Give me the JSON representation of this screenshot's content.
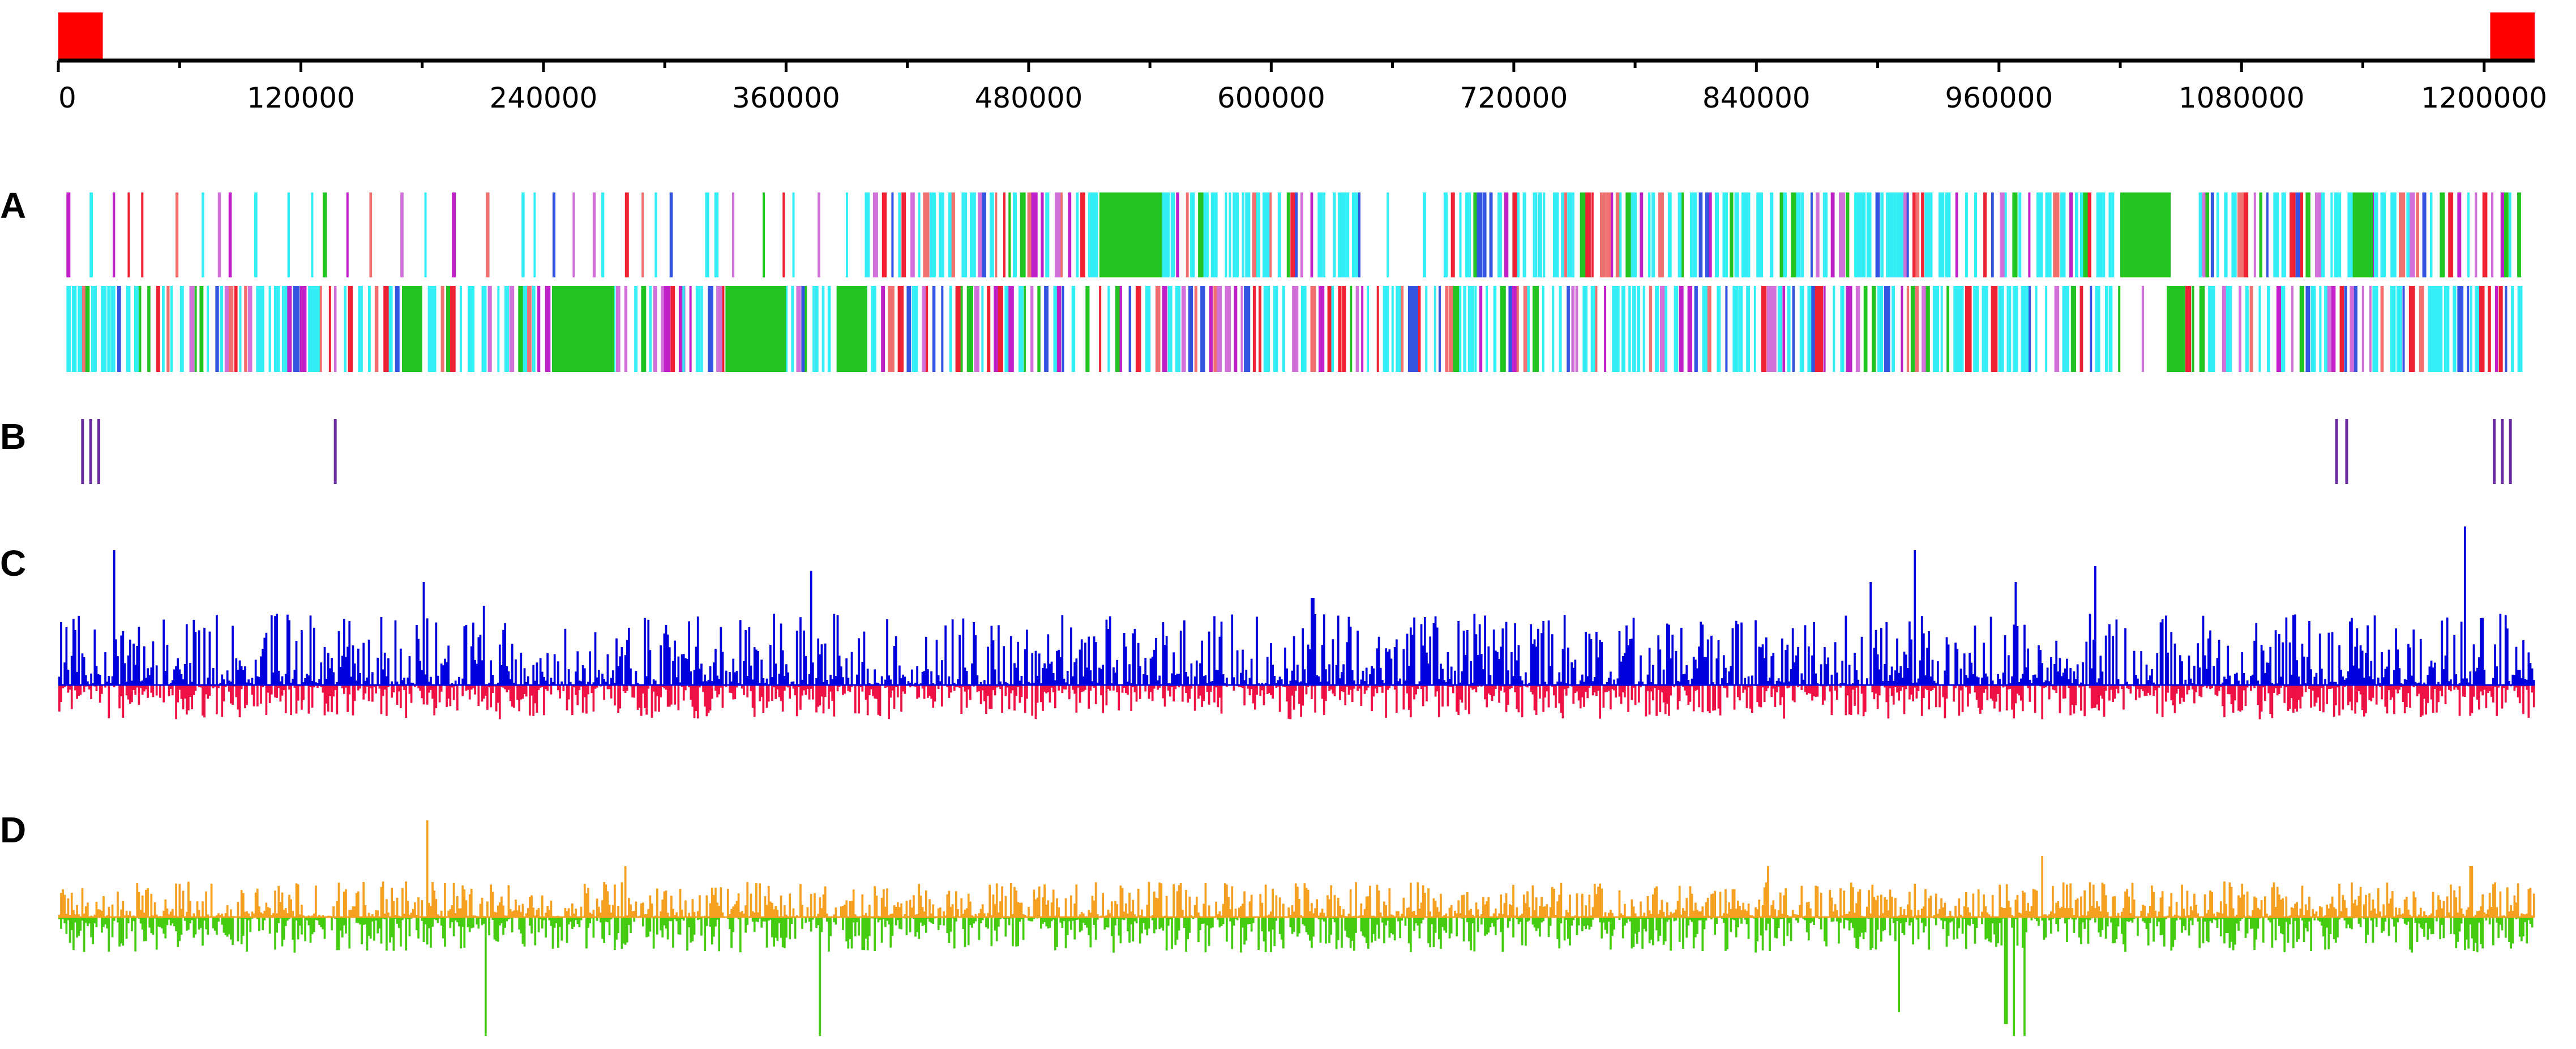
{
  "panels": {
    "A": {
      "label": "A"
    },
    "B": {
      "label": "B"
    },
    "C": {
      "label": "C"
    },
    "D": {
      "label": "D"
    }
  },
  "chart_data": {
    "type": "genome_map",
    "title": "",
    "xlabel": "",
    "ylabel": "",
    "xlim": [
      0,
      1225000
    ],
    "ticks": {
      "major": [
        0,
        120000,
        240000,
        360000,
        480000,
        600000,
        720000,
        840000,
        960000,
        1080000,
        1200000
      ],
      "labels": [
        "0",
        "120000",
        "240000",
        "360000",
        "480000",
        "600000",
        "720000",
        "840000",
        "960000",
        "1080000",
        "1200000"
      ],
      "minor_step": 60000
    },
    "colors": {
      "ruler": "#000000",
      "origin_marker": "#ff0000",
      "feature_cyan": "#33eef5",
      "feature_green": "#22c422",
      "feature_red": "#ee2233",
      "feature_magenta": "#c020c8",
      "feature_orchid": "#d070d8",
      "feature_blue": "#3355e0",
      "feature_salmon": "#f07070",
      "rna_marker": "#6a2aa0",
      "c_positive": "#0000dd",
      "c_negative": "#ee1144",
      "d_positive": "#f5a020",
      "d_negative": "#44cc11"
    },
    "ruler_markers": [
      {
        "start": 0,
        "end": 22000
      },
      {
        "start": 1203000,
        "end": 1225000
      }
    ],
    "panel_B_markers": [
      12000,
      16000,
      20000,
      137000,
      1127000,
      1132000,
      1205000,
      1209000,
      1213000
    ],
    "panel_A_dense_regions": [
      {
        "strand": "forward",
        "start": 390000,
        "end": 640000
      },
      {
        "strand": "forward",
        "start": 680000,
        "end": 1015000
      },
      {
        "strand": "forward",
        "start": 1045000,
        "end": 1225000
      },
      {
        "strand": "reverse",
        "start": 0,
        "end": 500000
      },
      {
        "strand": "reverse",
        "start": 510000,
        "end": 1015000
      },
      {
        "strand": "reverse",
        "start": 1045000,
        "end": 1225000
      }
    ],
    "panel_A_green_blocks": [
      {
        "strand": "forward",
        "start": 515000,
        "end": 545000
      },
      {
        "strand": "forward",
        "start": 1020000,
        "end": 1045000
      },
      {
        "strand": "forward",
        "start": 1135000,
        "end": 1145000
      },
      {
        "strand": "reverse",
        "start": 170000,
        "end": 180000
      },
      {
        "strand": "reverse",
        "start": 245000,
        "end": 275000
      },
      {
        "strand": "reverse",
        "start": 330000,
        "end": 360000
      },
      {
        "strand": "reverse",
        "start": 385000,
        "end": 400000
      },
      {
        "strand": "reverse",
        "start": 1043000,
        "end": 1052000
      }
    ],
    "panel_C_peaks": [
      {
        "x": 27000,
        "y": 0.85
      },
      {
        "x": 180000,
        "y": 0.65
      },
      {
        "x": 210000,
        "y": 0.5
      },
      {
        "x": 372000,
        "y": 0.72
      },
      {
        "x": 620000,
        "y": 0.55
      },
      {
        "x": 896000,
        "y": 0.65
      },
      {
        "x": 918000,
        "y": 0.85
      },
      {
        "x": 968000,
        "y": 0.65
      },
      {
        "x": 1007000,
        "y": 0.75
      },
      {
        "x": 1190000,
        "y": 1.0
      }
    ],
    "panel_D_peaks": [
      {
        "x": 182000,
        "y": 0.95
      },
      {
        "x": 280000,
        "y": 0.5
      },
      {
        "x": 845000,
        "y": 0.5
      },
      {
        "x": 981000,
        "y": 0.6
      },
      {
        "x": 1193000,
        "y": 0.5
      }
    ],
    "panel_D_troughs": [
      {
        "x": 211000,
        "y": -1.0
      },
      {
        "x": 376000,
        "y": -1.0
      },
      {
        "x": 910000,
        "y": -0.8
      },
      {
        "x": 963000,
        "y": -0.9
      },
      {
        "x": 967000,
        "y": -1.0
      },
      {
        "x": 972000,
        "y": -1.0
      }
    ]
  }
}
